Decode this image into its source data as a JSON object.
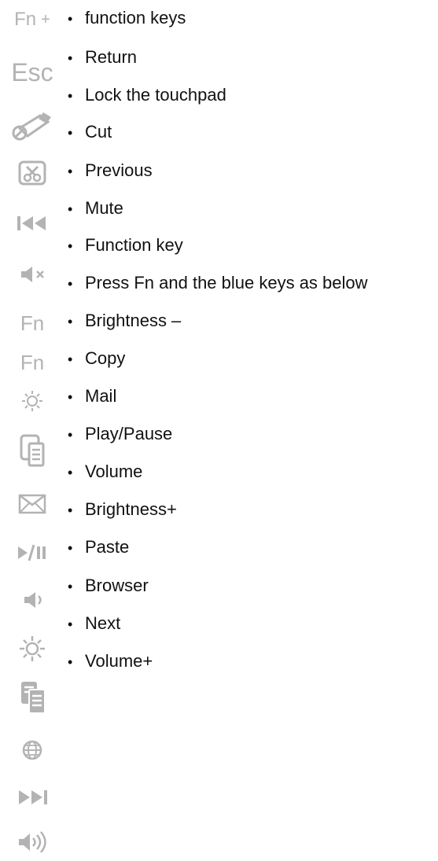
{
  "icons": {
    "fn_plus": {
      "label": "Fn",
      "plus": "+"
    },
    "esc": {
      "label": "Esc"
    },
    "touchpad_lock": {
      "name": "touchpad-lock-icon"
    },
    "cut": {
      "name": "cut-icon"
    },
    "previous": {
      "name": "previous-track-icon"
    },
    "mute": {
      "name": "mute-icon"
    },
    "fn_1": {
      "label": "Fn"
    },
    "fn_2": {
      "label": "Fn"
    },
    "brightness_down": {
      "name": "brightness-down-icon"
    },
    "copy": {
      "name": "copy-icon"
    },
    "mail": {
      "name": "mail-icon"
    },
    "play_pause": {
      "name": "play-pause-icon"
    },
    "volume_down": {
      "name": "volume-down-icon"
    },
    "brightness_up": {
      "name": "brightness-up-icon"
    },
    "paste": {
      "name": "paste-icon"
    },
    "browser": {
      "name": "globe-icon"
    },
    "next": {
      "name": "next-track-icon"
    },
    "volume_up": {
      "name": "volume-up-icon"
    }
  },
  "list": {
    "items": [
      "function keys",
      "Return",
      "Lock the touchpad",
      "Cut",
      "Previous",
      "Mute",
      "Function key",
      "Press Fn and the blue keys as below",
      "Brightness –",
      "Copy",
      "Mail",
      "Play/Pause",
      "Volume",
      "Brightness+",
      "Paste",
      "Browser",
      "Next",
      "Volume+"
    ],
    "bullet": "•"
  },
  "colors": {
    "icon_gray": "#b3b3b3",
    "text": "#111111",
    "background": "#ffffff"
  }
}
